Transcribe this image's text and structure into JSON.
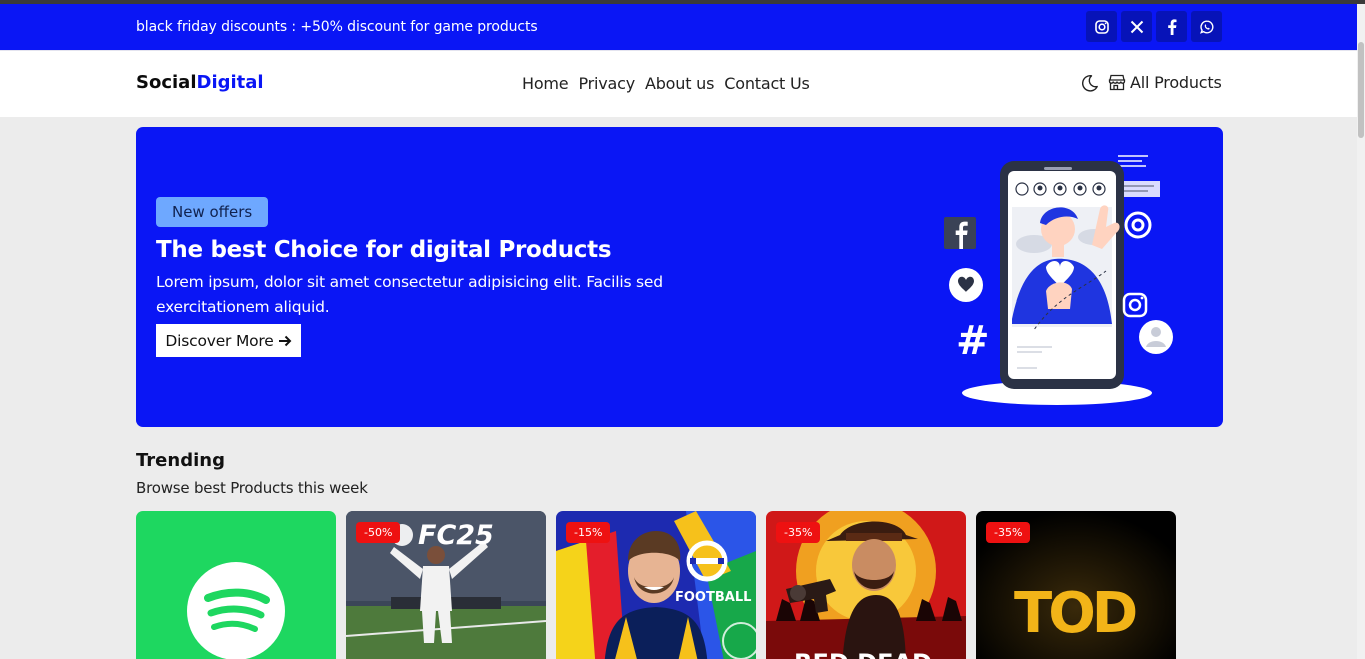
{
  "topbar": {
    "promo": "black friday discounts : +50% discount for game products",
    "socials": [
      {
        "icon": "instagram-icon"
      },
      {
        "icon": "x-twitter-icon"
      },
      {
        "icon": "facebook-icon"
      },
      {
        "icon": "whatsapp-icon"
      }
    ]
  },
  "navbar": {
    "logo_part1": "Social",
    "logo_part2": "Digital",
    "links": [
      "Home",
      "Privacy",
      "About us",
      "Contact Us"
    ],
    "theme_icon": "moon-icon",
    "all_products": "All Products"
  },
  "hero": {
    "badge": "New offers",
    "title": "The best Choice for digital Products",
    "description": "Lorem ipsum, dolor sit amet consectetur adipisicing elit. Facilis sed exercitationem aliquid.",
    "cta": "Discover More"
  },
  "trending": {
    "title": "Trending",
    "subtitle": "Browse best Products this week",
    "products": [
      {
        "name": "spotify",
        "discount": ""
      },
      {
        "name": "ea-fc25",
        "discount": "-50%",
        "logo_text": "FC25"
      },
      {
        "name": "efootball",
        "discount": "-15%",
        "logo_text": "FOOTBALL"
      },
      {
        "name": "red-dead-redemption",
        "discount": "-35%",
        "logo_text": "RED DEAD"
      },
      {
        "name": "tod",
        "discount": "-35%",
        "logo_text": "TOD"
      }
    ]
  },
  "colors": {
    "primary": "#0a16f5",
    "discount": "#ee1111",
    "spotify": "#1ed760",
    "badge": "#6ea8ff"
  }
}
